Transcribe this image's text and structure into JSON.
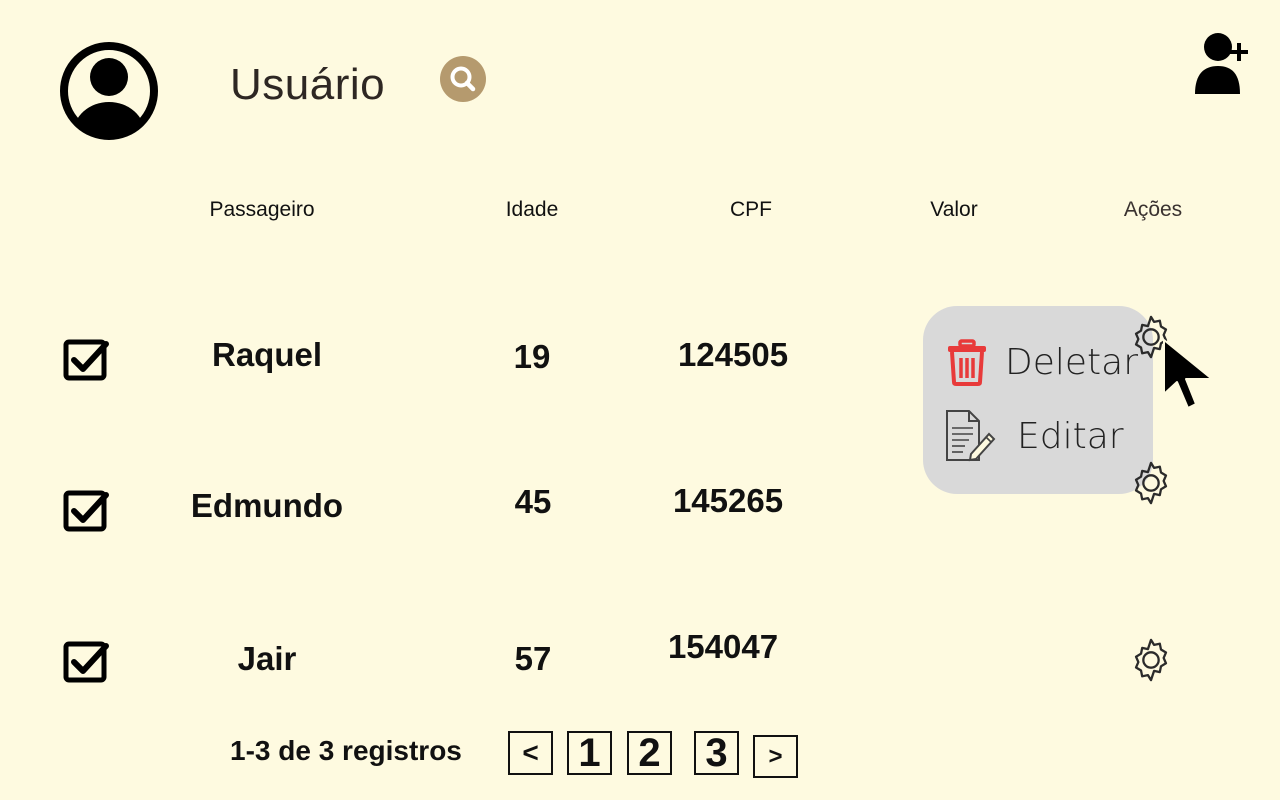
{
  "header": {
    "title": "Usuário",
    "avatar_icon": "user-circle-icon",
    "search_icon": "search-icon",
    "add_user_icon": "user-add-icon"
  },
  "columns": {
    "passenger": "Passageiro",
    "age": "Idade",
    "cpf": "CPF",
    "value": "Valor",
    "actions": "Ações"
  },
  "rows": [
    {
      "checked": true,
      "name": "Raquel",
      "age": "19",
      "cpf": "124505",
      "value": ""
    },
    {
      "checked": true,
      "name": "Edmundo",
      "age": "45",
      "cpf": "145265",
      "value": ""
    },
    {
      "checked": true,
      "name": "Jair",
      "age": "57",
      "cpf": "154047",
      "value": ""
    }
  ],
  "context_menu": {
    "delete_label": "Deletar",
    "edit_label": "Editar",
    "delete_icon": "trash-icon",
    "edit_icon": "document-edit-icon"
  },
  "pagination": {
    "info": "1-3  de 3 registros",
    "prev": "<",
    "pages": [
      "1",
      "2",
      "3"
    ],
    "next": ">"
  },
  "colors": {
    "background": "#fefae0",
    "search_button": "#b59a6e",
    "menu_background": "#d9d9d9",
    "delete_icon": "#e83a3a"
  }
}
